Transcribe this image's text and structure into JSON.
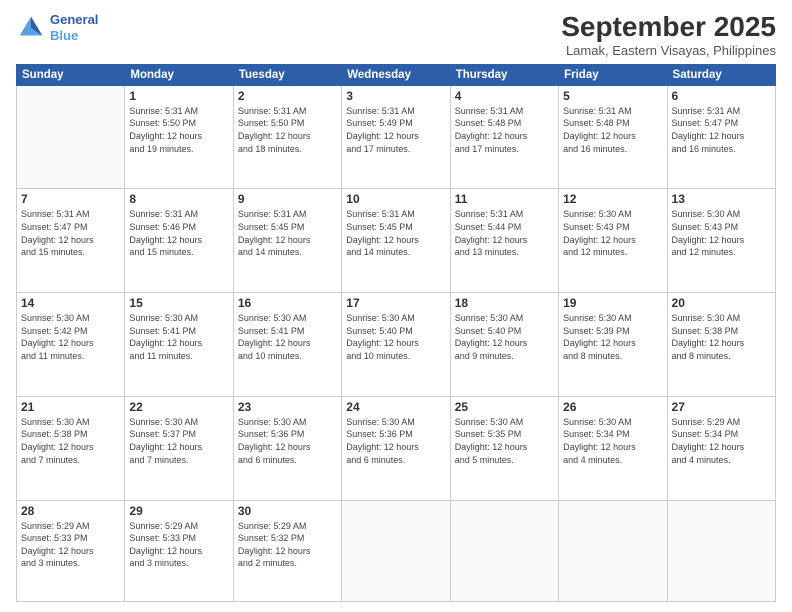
{
  "logo": {
    "line1": "General",
    "line2": "Blue"
  },
  "title": "September 2025",
  "subtitle": "Lamak, Eastern Visayas, Philippines",
  "weekdays": [
    "Sunday",
    "Monday",
    "Tuesday",
    "Wednesday",
    "Thursday",
    "Friday",
    "Saturday"
  ],
  "weeks": [
    [
      {
        "day": "",
        "info": ""
      },
      {
        "day": "1",
        "info": "Sunrise: 5:31 AM\nSunset: 5:50 PM\nDaylight: 12 hours\nand 19 minutes."
      },
      {
        "day": "2",
        "info": "Sunrise: 5:31 AM\nSunset: 5:50 PM\nDaylight: 12 hours\nand 18 minutes."
      },
      {
        "day": "3",
        "info": "Sunrise: 5:31 AM\nSunset: 5:49 PM\nDaylight: 12 hours\nand 17 minutes."
      },
      {
        "day": "4",
        "info": "Sunrise: 5:31 AM\nSunset: 5:48 PM\nDaylight: 12 hours\nand 17 minutes."
      },
      {
        "day": "5",
        "info": "Sunrise: 5:31 AM\nSunset: 5:48 PM\nDaylight: 12 hours\nand 16 minutes."
      },
      {
        "day": "6",
        "info": "Sunrise: 5:31 AM\nSunset: 5:47 PM\nDaylight: 12 hours\nand 16 minutes."
      }
    ],
    [
      {
        "day": "7",
        "info": "Sunrise: 5:31 AM\nSunset: 5:47 PM\nDaylight: 12 hours\nand 15 minutes."
      },
      {
        "day": "8",
        "info": "Sunrise: 5:31 AM\nSunset: 5:46 PM\nDaylight: 12 hours\nand 15 minutes."
      },
      {
        "day": "9",
        "info": "Sunrise: 5:31 AM\nSunset: 5:45 PM\nDaylight: 12 hours\nand 14 minutes."
      },
      {
        "day": "10",
        "info": "Sunrise: 5:31 AM\nSunset: 5:45 PM\nDaylight: 12 hours\nand 14 minutes."
      },
      {
        "day": "11",
        "info": "Sunrise: 5:31 AM\nSunset: 5:44 PM\nDaylight: 12 hours\nand 13 minutes."
      },
      {
        "day": "12",
        "info": "Sunrise: 5:30 AM\nSunset: 5:43 PM\nDaylight: 12 hours\nand 12 minutes."
      },
      {
        "day": "13",
        "info": "Sunrise: 5:30 AM\nSunset: 5:43 PM\nDaylight: 12 hours\nand 12 minutes."
      }
    ],
    [
      {
        "day": "14",
        "info": "Sunrise: 5:30 AM\nSunset: 5:42 PM\nDaylight: 12 hours\nand 11 minutes."
      },
      {
        "day": "15",
        "info": "Sunrise: 5:30 AM\nSunset: 5:41 PM\nDaylight: 12 hours\nand 11 minutes."
      },
      {
        "day": "16",
        "info": "Sunrise: 5:30 AM\nSunset: 5:41 PM\nDaylight: 12 hours\nand 10 minutes."
      },
      {
        "day": "17",
        "info": "Sunrise: 5:30 AM\nSunset: 5:40 PM\nDaylight: 12 hours\nand 10 minutes."
      },
      {
        "day": "18",
        "info": "Sunrise: 5:30 AM\nSunset: 5:40 PM\nDaylight: 12 hours\nand 9 minutes."
      },
      {
        "day": "19",
        "info": "Sunrise: 5:30 AM\nSunset: 5:39 PM\nDaylight: 12 hours\nand 8 minutes."
      },
      {
        "day": "20",
        "info": "Sunrise: 5:30 AM\nSunset: 5:38 PM\nDaylight: 12 hours\nand 8 minutes."
      }
    ],
    [
      {
        "day": "21",
        "info": "Sunrise: 5:30 AM\nSunset: 5:38 PM\nDaylight: 12 hours\nand 7 minutes."
      },
      {
        "day": "22",
        "info": "Sunrise: 5:30 AM\nSunset: 5:37 PM\nDaylight: 12 hours\nand 7 minutes."
      },
      {
        "day": "23",
        "info": "Sunrise: 5:30 AM\nSunset: 5:36 PM\nDaylight: 12 hours\nand 6 minutes."
      },
      {
        "day": "24",
        "info": "Sunrise: 5:30 AM\nSunset: 5:36 PM\nDaylight: 12 hours\nand 6 minutes."
      },
      {
        "day": "25",
        "info": "Sunrise: 5:30 AM\nSunset: 5:35 PM\nDaylight: 12 hours\nand 5 minutes."
      },
      {
        "day": "26",
        "info": "Sunrise: 5:30 AM\nSunset: 5:34 PM\nDaylight: 12 hours\nand 4 minutes."
      },
      {
        "day": "27",
        "info": "Sunrise: 5:29 AM\nSunset: 5:34 PM\nDaylight: 12 hours\nand 4 minutes."
      }
    ],
    [
      {
        "day": "28",
        "info": "Sunrise: 5:29 AM\nSunset: 5:33 PM\nDaylight: 12 hours\nand 3 minutes."
      },
      {
        "day": "29",
        "info": "Sunrise: 5:29 AM\nSunset: 5:33 PM\nDaylight: 12 hours\nand 3 minutes."
      },
      {
        "day": "30",
        "info": "Sunrise: 5:29 AM\nSunset: 5:32 PM\nDaylight: 12 hours\nand 2 minutes."
      },
      {
        "day": "",
        "info": ""
      },
      {
        "day": "",
        "info": ""
      },
      {
        "day": "",
        "info": ""
      },
      {
        "day": "",
        "info": ""
      }
    ]
  ]
}
